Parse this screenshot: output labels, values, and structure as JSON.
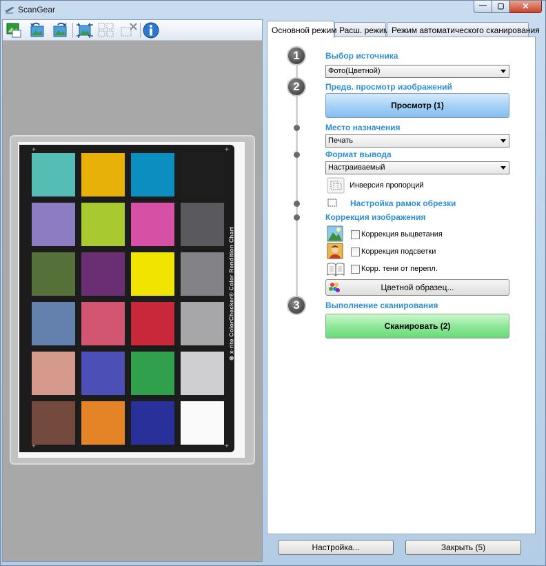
{
  "window": {
    "title": "ScanGear",
    "min_glyph": "—",
    "max_glyph": "▢",
    "close_glyph": "✕"
  },
  "toolbar": {
    "buttons": [
      "crop-image-icon",
      "rotate-left-icon",
      "rotate-right-icon",
      "auto-crop-icon",
      "select-all-frames-icon",
      "remove-frame-icon",
      "info-icon"
    ]
  },
  "chart": {
    "side_text": "⊗ x·rite ColorChecker® Color Rendition Chart",
    "patches": [
      [
        "#55bdb3",
        "#e8b10a",
        "#0c8ec0",
        "#1e1e1e"
      ],
      [
        "#8e7cc2",
        "#a8c92f",
        "#d651a6",
        "#5a5a5e"
      ],
      [
        "#56703a",
        "#6a2f72",
        "#f2e401",
        "#838387"
      ],
      [
        "#6480ac",
        "#d25672",
        "#c8283a",
        "#a7a7aa"
      ],
      [
        "#d69a8c",
        "#4c50b6",
        "#31a04c",
        "#cfcfd2"
      ],
      [
        "#744a3e",
        "#e58426",
        "#2a3099",
        "#fafafa"
      ]
    ]
  },
  "tabs": [
    "Основной режим",
    "Расш. режим",
    "Режим автоматического сканирования"
  ],
  "steps": {
    "s1_number": "1",
    "s1_label": "Выбор источника",
    "source_value": "Фото(Цветной)",
    "s2_number": "2",
    "s2_label": "Предв. просмотр изображений",
    "preview_button": "Просмотр (1)",
    "dest_label": "Место назначения",
    "dest_value": "Печать",
    "format_label": "Формат вывода",
    "format_value": "Настраиваемый",
    "inversion_label": "Инверсия пропорций",
    "crop_label": "Настройка рамок обрезки",
    "correction_label": "Коррекция изображения",
    "fade_label": "Коррекция выцветания",
    "backlight_label": "Коррекция подсветки",
    "gutter_label": "Корр. тени от перепл.",
    "color_pattern_button": "Цветной образец...",
    "s3_number": "3",
    "s3_label": "Выполнение сканирования",
    "scan_button": "Сканировать (2)"
  },
  "bottom": {
    "settings_button": "Настройка...",
    "close_button": "Закрыть (5)"
  },
  "colors": {
    "accent": "#2c8fd6",
    "preview_btn": "#84bff0",
    "scan_btn": "#6ad97a"
  }
}
